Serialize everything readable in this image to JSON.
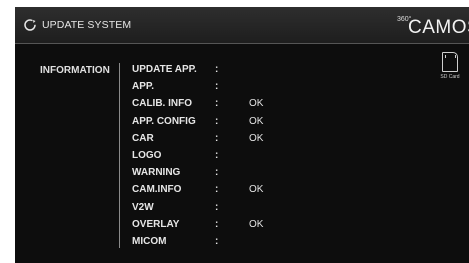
{
  "header": {
    "title": "UPDATE SYSTEM",
    "icon": "refresh-icon"
  },
  "logo": {
    "sup": "360°",
    "text": "CAMOS"
  },
  "sd_card": {
    "icon": "sd-card-icon",
    "label": "SD Card"
  },
  "info_label": "INFORMATION",
  "items": [
    {
      "name": "UPDATE APP.",
      "colon": ":",
      "status": ""
    },
    {
      "name": "APP.",
      "colon": ":",
      "status": ""
    },
    {
      "name": "CALIB. INFO",
      "colon": ":",
      "status": "OK"
    },
    {
      "name": "APP. CONFIG",
      "colon": ":",
      "status": "OK"
    },
    {
      "name": "CAR",
      "colon": ":",
      "status": "OK"
    },
    {
      "name": "LOGO",
      "colon": ":",
      "status": ""
    },
    {
      "name": "WARNING",
      "colon": ":",
      "status": ""
    },
    {
      "name": "CAM.INFO",
      "colon": ":",
      "status": "OK"
    },
    {
      "name": "V2W",
      "colon": ":",
      "status": ""
    },
    {
      "name": "OVERLAY",
      "colon": ":",
      "status": "OK"
    },
    {
      "name": "MICOM",
      "colon": ":",
      "status": ""
    }
  ]
}
